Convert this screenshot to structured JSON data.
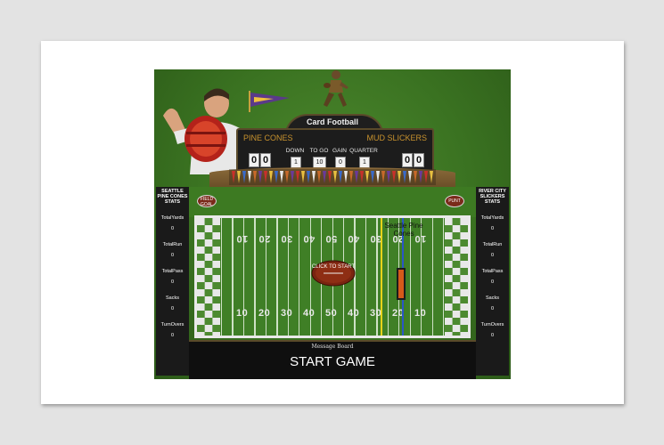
{
  "scoreboard": {
    "title": "Card Football",
    "home_team": "PINE CONES",
    "away_team": "MUD SLICKERS",
    "home_score": [
      "0",
      "0"
    ],
    "away_score": [
      "0",
      "0"
    ],
    "labels": {
      "down": "DOWN",
      "to_go": "TO GO",
      "gain": "GAIN",
      "quarter": "QUARTER"
    },
    "values": {
      "down": "1",
      "to_go": "10",
      "gain": "0",
      "quarter": "1"
    }
  },
  "left_stats": {
    "header": "SEATTLE PINE CONES STATS",
    "rows": [
      {
        "label": "TotalYards",
        "value": "0"
      },
      {
        "label": "TotalRun",
        "value": "0"
      },
      {
        "label": "TotalPass",
        "value": "0"
      },
      {
        "label": "Sacks",
        "value": "0"
      },
      {
        "label": "TurnOvers",
        "value": "0"
      }
    ]
  },
  "right_stats": {
    "header": "RIVER CITY SLICKERS STATS",
    "rows": [
      {
        "label": "TotalYards",
        "value": "0"
      },
      {
        "label": "TotalRun",
        "value": "0"
      },
      {
        "label": "TotalPass",
        "value": "0"
      },
      {
        "label": "Sacks",
        "value": "0"
      },
      {
        "label": "TurnOvers",
        "value": "0"
      }
    ]
  },
  "buttons": {
    "field_goal": "FIELD GOAL",
    "punt": "PUNT"
  },
  "field": {
    "yard_numbers": [
      "10",
      "20",
      "30",
      "40",
      "50",
      "40",
      "30",
      "20",
      "10"
    ],
    "ball_label": "CLICK TO START",
    "possession_team": "Seattle Pine Cones"
  },
  "message_board": {
    "title": "Message Board",
    "text": "START GAME"
  },
  "colors": {
    "turf": "#3f7f26",
    "scoreboard_team_text": "#c8922e",
    "first_down_line": "#e6d21a",
    "scrimmage_line": "#2a56c8"
  }
}
